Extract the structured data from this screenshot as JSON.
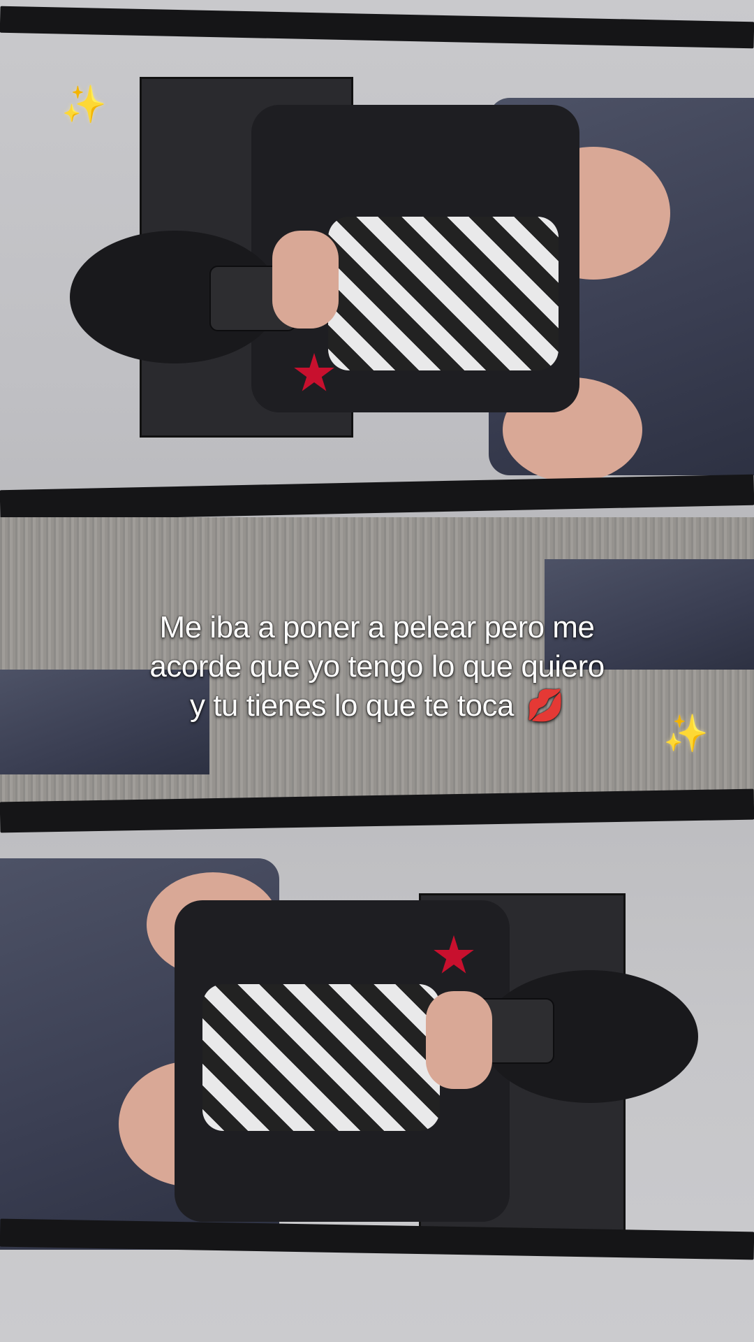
{
  "caption": {
    "line1": "Me iba a poner a pelear pero me",
    "line2": "acorde que yo tengo lo que quiero",
    "line3": "y tu tienes lo que te toca",
    "emoji": "💋"
  },
  "decorations": {
    "sparkle_top": "✨",
    "sparkle_right": "✨"
  },
  "colors": {
    "caption_text": "#ffffff",
    "accent_star": "#c8102e",
    "mirror_frame": "#151517"
  }
}
